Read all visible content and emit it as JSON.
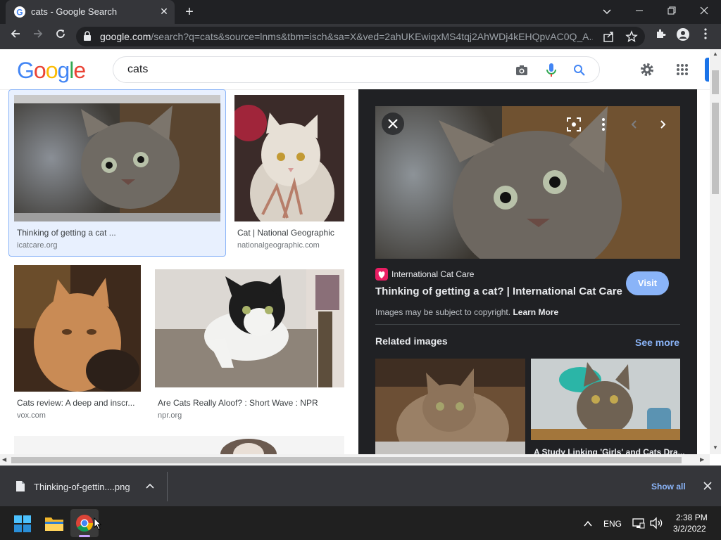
{
  "browser": {
    "tab_title": "cats - Google Search",
    "url_domain": "google.com",
    "url_path": "/search?q=cats&source=lnms&tbm=isch&sa=X&ved=2ahUKEwiqxMS4tqj2AhWDj4kEHQpvAC0Q_A...",
    "new_tab_symbol": "+",
    "close_symbol": "✕"
  },
  "google": {
    "logo_letters": [
      "G",
      "o",
      "o",
      "g",
      "l",
      "e"
    ],
    "logo_colors": [
      "#4285F4",
      "#EA4335",
      "#FBBC05",
      "#4285F4",
      "#34A853",
      "#EA4335"
    ],
    "query": "cats"
  },
  "results": [
    {
      "caption": "Thinking of getting a cat ...",
      "source": "icatcare.org"
    },
    {
      "caption": "Cat | National Geographic",
      "source": "nationalgeographic.com"
    },
    {
      "caption": "Cats review: A deep and inscr...",
      "source": "vox.com"
    },
    {
      "caption": "Are Cats Really Aloof? : Short Wave : NPR",
      "source": "npr.org"
    }
  ],
  "panel": {
    "site_name": "International Cat Care",
    "title": "Thinking of getting a cat? | International Cat Care",
    "visit_label": "Visit",
    "copyright_text": "Images may be subject to copyright.",
    "learn_more": "Learn More",
    "related_heading": "Related images",
    "see_more": "See more",
    "related_caption_2": "A Study Linking 'Girls' and Cats Dra..."
  },
  "downloads": {
    "file_name": "Thinking-of-gettin....png",
    "show_all": "Show all"
  },
  "taskbar": {
    "language": "ENG",
    "time": "2:38 PM",
    "date": "3/2/2022"
  },
  "colors": {
    "chrome_dark": "#202124",
    "chrome_toolbar": "#35363a",
    "accent_blue": "#8ab4f8",
    "selected_bg": "#e8f0fe"
  }
}
